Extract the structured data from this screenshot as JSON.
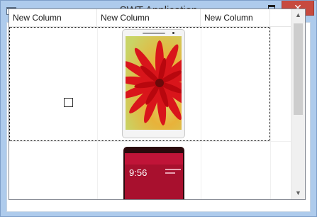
{
  "window": {
    "title": "SWT Application",
    "close_glyph": "✕"
  },
  "table": {
    "columns": [
      "New Column",
      "New Column",
      "New Column",
      ""
    ],
    "rows": [
      {
        "checked": false,
        "image": "red-flower-phone-image"
      },
      {
        "checked": false,
        "image": "red-phone-image",
        "clock_text": "9:56"
      }
    ]
  },
  "icons": {
    "app": "window-icon",
    "minimize": "minimize-icon",
    "maximize": "maximize-icon",
    "close": "close-icon",
    "scroll_up": "chevron-up-icon",
    "scroll_down": "chevron-down-icon"
  },
  "colors": {
    "title_bar": "#aecbec",
    "close_button": "#c74a3f",
    "scroll_thumb": "#cdcdcd"
  }
}
